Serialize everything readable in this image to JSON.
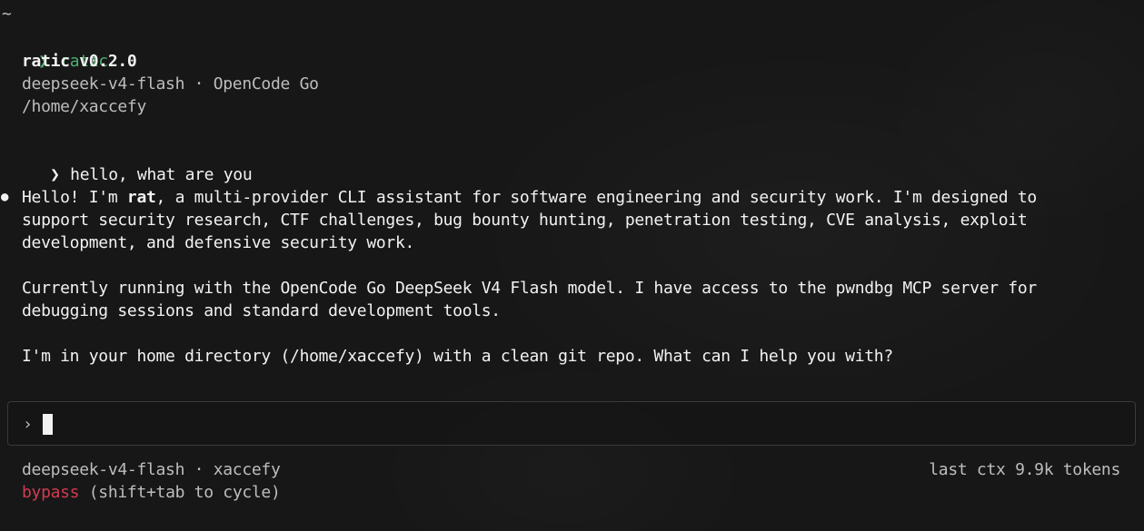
{
  "terminal": {
    "cwd_marker": "~",
    "shell_prompt": {
      "glyph": "❯",
      "command": "ratic"
    },
    "banner": {
      "title": "ratic v0.2.0",
      "model_line": "deepseek-v4-flash · OpenCode Go",
      "path": "/home/xaccefy"
    },
    "user_message": {
      "glyph": "❯",
      "text": "hello, what are you"
    },
    "assistant_message": {
      "bullet": "●",
      "line1_pre": "Hello! I'm ",
      "line1_bold": "rat",
      "line1_post": ", a multi-provider CLI assistant for software engineering and security work. I'm designed to",
      "line2": "support security research, CTF challenges, bug bounty hunting, penetration testing, CVE analysis, exploit",
      "line3": "development, and defensive security work.",
      "line4": "Currently running with the OpenCode Go DeepSeek V4 Flash model. I have access to the pwndbg MCP server for",
      "line5": "debugging sessions and standard development tools.",
      "line6": "I'm in your home directory (/home/xaccefy) with a clean git repo. What can I help you with?"
    },
    "input": {
      "chevron": "›",
      "value": ""
    },
    "status": {
      "model_user": "deepseek-v4-flash · xaccefy",
      "context": "last ctx 9.9k tokens",
      "mode": "bypass",
      "mode_hint": " (shift+tab to cycle)"
    }
  },
  "colors": {
    "background": "#171717",
    "prompt_green": "#4caf6e",
    "mode_red": "#d23b50",
    "text": "#cfcfcf",
    "text_bright": "#f2f2f2"
  }
}
